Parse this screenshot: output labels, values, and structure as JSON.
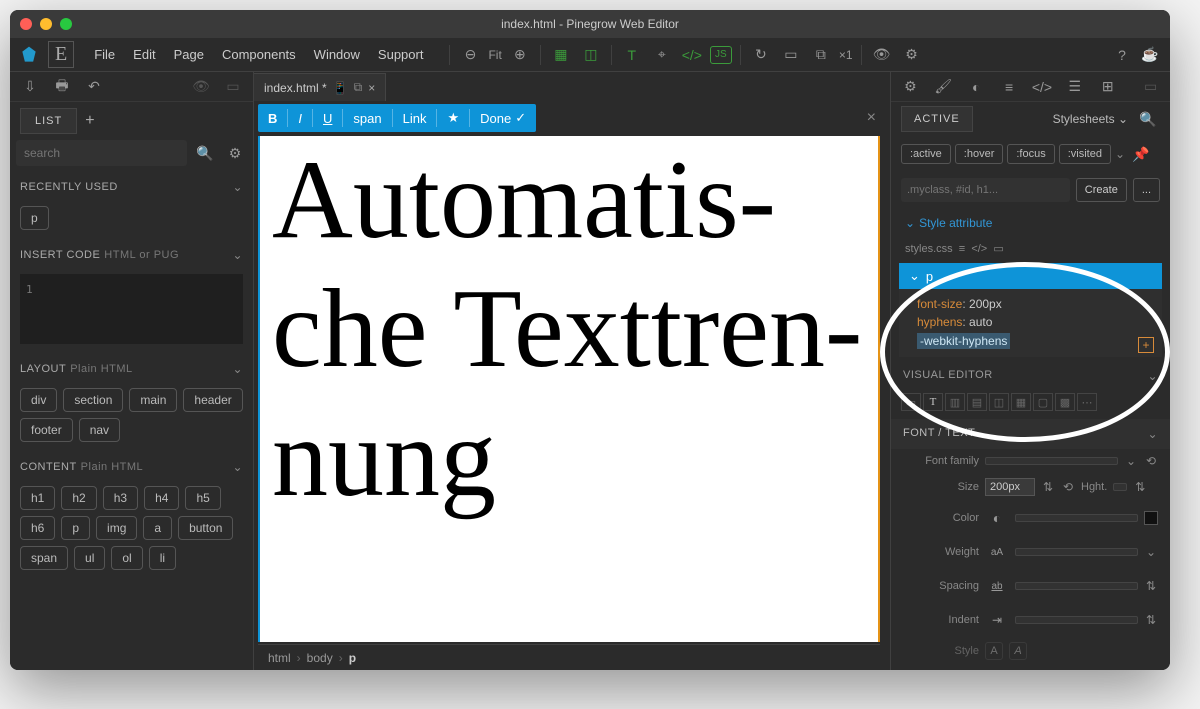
{
  "window": {
    "title": "index.html - Pinegrow Web Editor"
  },
  "menubar": {
    "items": [
      "File",
      "Edit",
      "Page",
      "Components",
      "Window",
      "Support"
    ],
    "fit_label": "Fit",
    "x_label": "×1"
  },
  "left": {
    "list_tab": "LIST",
    "search_placeholder": "search",
    "recently_used": {
      "title": "RECENTLY USED",
      "tags": [
        "p"
      ]
    },
    "insert_code": {
      "title": "INSERT CODE",
      "sub": "HTML or PUG",
      "line": "1"
    },
    "layout": {
      "title": "LAYOUT",
      "sub": "Plain HTML",
      "tags": [
        "div",
        "section",
        "main",
        "header",
        "footer",
        "nav"
      ]
    },
    "content": {
      "title": "CONTENT",
      "sub": "Plain HTML",
      "tags": [
        "h1",
        "h2",
        "h3",
        "h4",
        "h5",
        "h6",
        "p",
        "img",
        "a",
        "button",
        "span",
        "ul",
        "ol",
        "li"
      ]
    }
  },
  "center": {
    "tab_label": "index.html *",
    "edit_bar": {
      "bold": "B",
      "italic": "I",
      "underline": "U",
      "span": "span",
      "link": "Link",
      "star": "★",
      "done": "Done",
      "check": "✓"
    },
    "canvas_text": "Automatis­che Texttren­nung",
    "breadcrumb": [
      "html",
      "body",
      "p"
    ]
  },
  "right": {
    "active_tab": "ACTIVE",
    "stylesheets": "Stylesheets",
    "pseudo": [
      ":active",
      ":hover",
      ":focus",
      ":visited"
    ],
    "selector_placeholder": ".myclass, #id, h1...",
    "create": "Create",
    "dots": "...",
    "style_attribute": "Style attribute",
    "styles_src": "styles.css",
    "rule": {
      "selector": "p",
      "lines": [
        {
          "prop": "font-size",
          "val": "200px"
        },
        {
          "prop": "hyphens",
          "val": "auto"
        }
      ],
      "editing": "-webkit-hyphens"
    },
    "visual_editor": "VISUAL EDITOR",
    "font_text": "FONT / TEXT",
    "font_family": "Font family",
    "size_label": "Size",
    "size_value": "200px",
    "hght_label": "Hght.",
    "color_label": "Color",
    "weight_label": "Weight",
    "spacing_label": "Spacing",
    "indent_label": "Indent",
    "style_label": "Style"
  }
}
